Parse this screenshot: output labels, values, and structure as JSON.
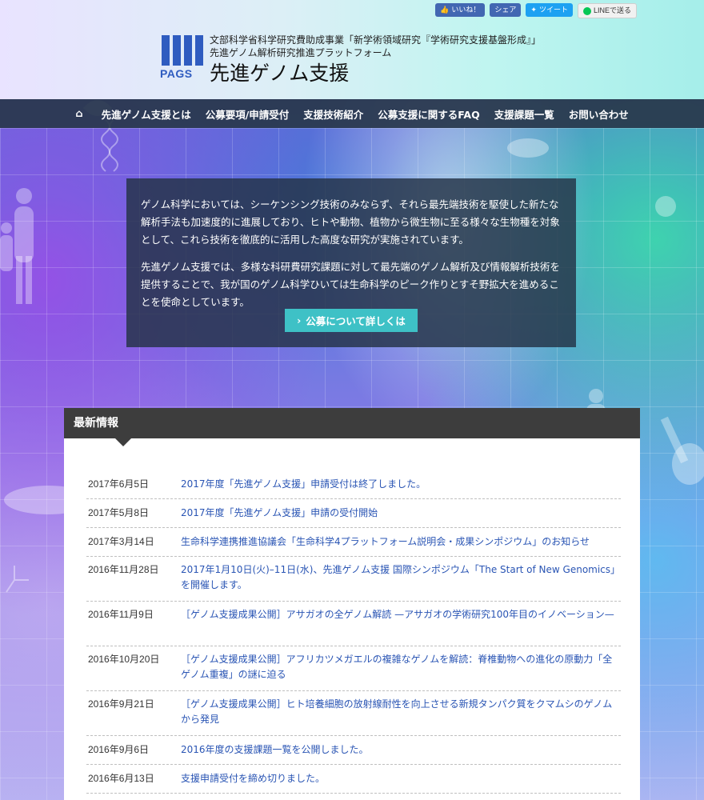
{
  "social": {
    "like": "いいね！",
    "share": "シェア",
    "tweet": "ツイート",
    "line": "LINEで送る"
  },
  "header": {
    "logo_mark": "PAGS",
    "line1": "文部科学省科学研究費助成事業「新学術領域研究『学術研究支援基盤形成』」",
    "line2": "先進ゲノム解析研究推進プラットフォーム",
    "title": "先進ゲノム支援"
  },
  "nav": {
    "items": [
      {
        "label": "先進ゲノム支援とは"
      },
      {
        "label": "公募要項/申請受付"
      },
      {
        "label": "支援技術紹介"
      },
      {
        "label": "公募支援に関するFAQ"
      },
      {
        "label": "支援課題一覧"
      },
      {
        "label": "お問い合わせ"
      }
    ]
  },
  "intro": {
    "p1": "ゲノム科学においては、シーケンシング技術のみならず、それら最先端技術を駆使した新たな解析手法も加速度的に進展しており、ヒトや動物、植物から微生物に至る様々な生物種を対象として、これら技術を徹底的に活用した高度な研究が実施されています。",
    "p2": "先進ゲノム支援では、多様な科研費研究課題に対して最先端のゲノム解析及び情報解析技術を提供することで、我が国のゲノム科学ひいては生命科学のピーク作りとすそ野拡大を進めることを使命としています。",
    "cta": "公募について詳しくは"
  },
  "news": {
    "heading": "最新情報",
    "items": [
      {
        "date": "2017年6月5日",
        "title": "2017年度「先進ゲノム支援」申請受付は終了しました。"
      },
      {
        "date": "2017年5月8日",
        "title": "2017年度「先進ゲノム支援」申請の受付開始"
      },
      {
        "date": "2017年3月14日",
        "title": "生命科学連携推進協議会「生命科学4プラットフォーム説明会・成果シンポジウム」のお知らせ"
      },
      {
        "date": "2016年11月28日",
        "title": "2017年1月10日(火)–11日(水)、先進ゲノム支援 国際シンポジウム「The Start of New Genomics」を開催します。"
      },
      {
        "date": "2016年11月9日",
        "title": "［ゲノム支援成果公開］アサガオの全ゲノム解読 —アサガオの学術研究100年目のイノベーション—"
      },
      {
        "date": "2016年10月20日",
        "title": "［ゲノム支援成果公開］アフリカツメガエルの複雑なゲノムを解読：脊椎動物への進化の原動力「全ゲノム重複」の謎に迫る"
      },
      {
        "date": "2016年9月21日",
        "title": "［ゲノム支援成果公開］ヒト培養細胞の放射線耐性を向上させる新規タンパク質をクマムシのゲノムから発見"
      },
      {
        "date": "2016年9月6日",
        "title": "2016年度の支援課題一覧を公開しました。"
      },
      {
        "date": "2016年6月13日",
        "title": "支援申請受付を締め切りました。"
      }
    ]
  }
}
